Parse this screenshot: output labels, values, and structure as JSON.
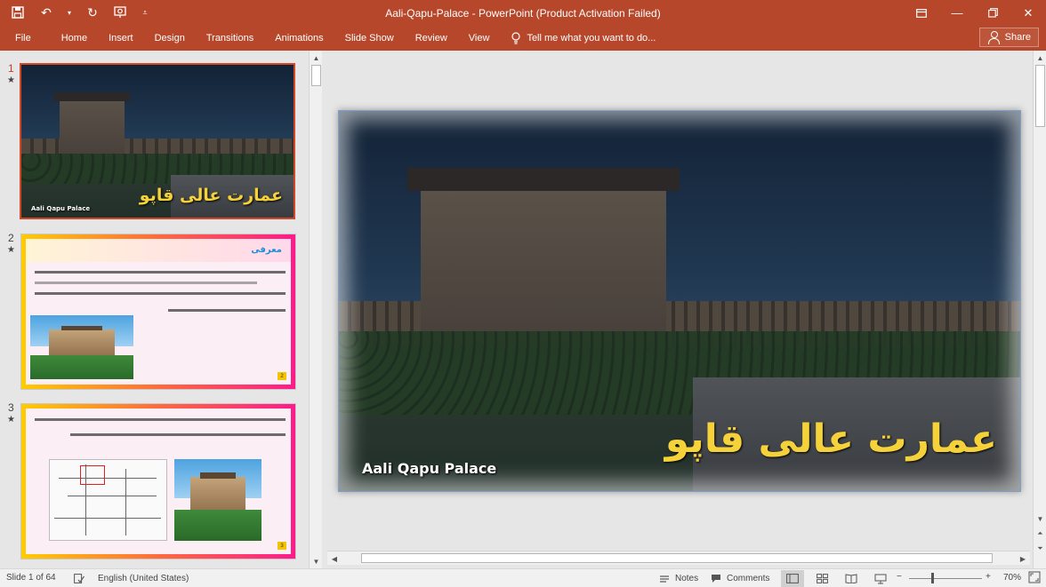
{
  "window": {
    "title": "Aali-Qapu-Palace - PowerPoint (Product Activation Failed)"
  },
  "ribbon": {
    "tabs": [
      "File",
      "Home",
      "Insert",
      "Design",
      "Transitions",
      "Animations",
      "Slide Show",
      "Review",
      "View"
    ],
    "tell_me": "Tell me what you want to do...",
    "share": "Share"
  },
  "thumbnails": [
    {
      "number": "1",
      "title": "عمارت عالی قاپو",
      "subtitle": "Aali Qapu Palace"
    },
    {
      "number": "2",
      "title": "معرفی",
      "page": "2"
    },
    {
      "number": "3",
      "page": "3"
    }
  ],
  "main_slide": {
    "title": "عمارت عالی قاپو",
    "subtitle": "Aali Qapu Palace"
  },
  "status": {
    "slide_info": "Slide 1 of 64",
    "language": "English (United States)",
    "notes": "Notes",
    "comments": "Comments",
    "zoom": "70%"
  },
  "colors": {
    "accent": "#b7472a",
    "selection": "#d24726",
    "title_yellow": "#f5d23a"
  }
}
